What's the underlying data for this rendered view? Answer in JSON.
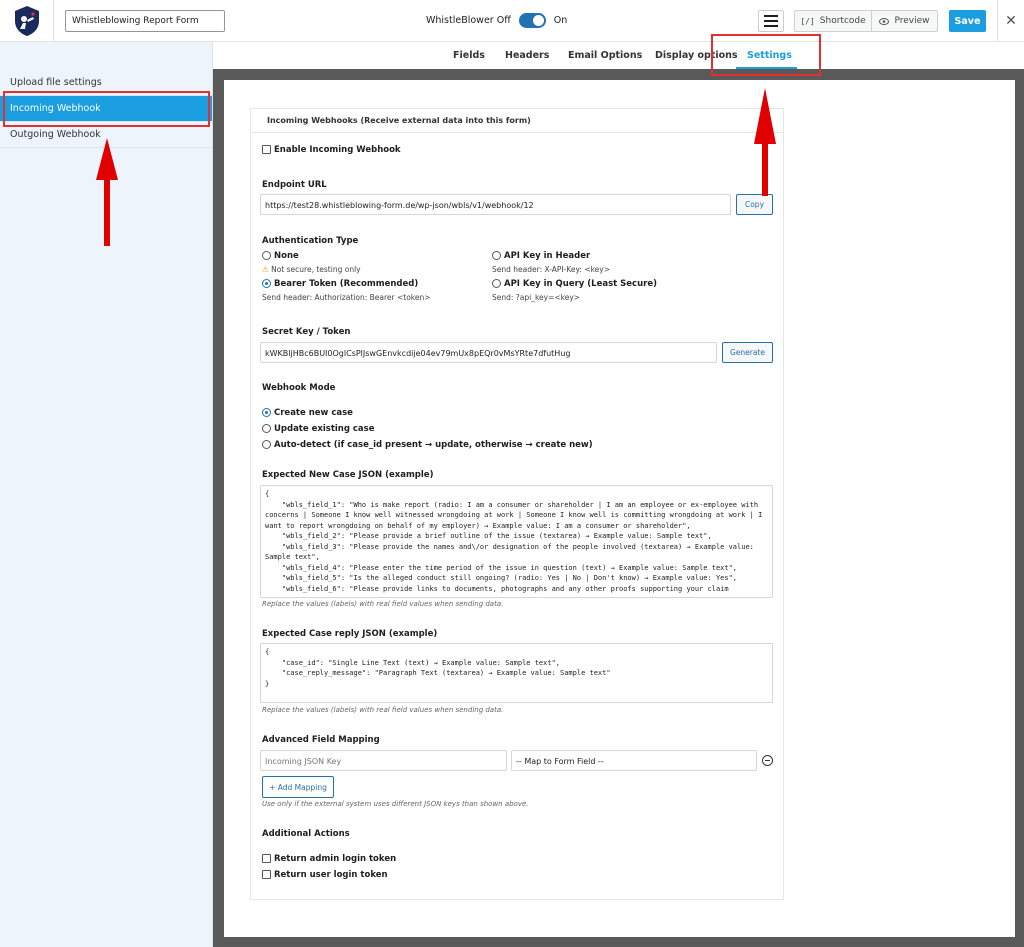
{
  "header": {
    "form_title": "Whistleblowing Report Form",
    "toggle_label_off": "WhistleBlower Off",
    "toggle_label_on": "On",
    "shortcode_label": "Shortcode",
    "shortcode_icon_text": "[/]",
    "preview_label": "Preview",
    "save_label": "Save",
    "close_icon": "close-icon",
    "accent_color": "#1a9ee0"
  },
  "sidebar": {
    "items": [
      {
        "label": "Upload file settings",
        "active": false
      },
      {
        "label": "Incoming Webhook",
        "active": true
      },
      {
        "label": "Outgoing Webhook",
        "active": false
      }
    ]
  },
  "tabs": [
    {
      "label": "Fields",
      "active": false
    },
    {
      "label": "Headers",
      "active": false
    },
    {
      "label": "Email Options",
      "active": false
    },
    {
      "label": "Display options",
      "active": false
    },
    {
      "label": "Settings",
      "active": true
    }
  ],
  "panel": {
    "header": "Incoming Webhooks (Receive external data into this form)",
    "enable_label": "Enable Incoming Webhook",
    "endpoint": {
      "label": "Endpoint URL",
      "value": "https://test28.whistleblowing-form.de/wp-json/wbls/v1/webhook/12",
      "copy_label": "Copy"
    },
    "auth": {
      "label": "Authentication Type",
      "options": [
        {
          "label": "None",
          "hint": "Not secure, testing only",
          "selected": false
        },
        {
          "label": "API Key in Header",
          "hint": "Send header: X-API-Key: <key>",
          "selected": false
        },
        {
          "label": "Bearer Token (Recommended)",
          "hint": "Send header: Authorization: Bearer <token>",
          "selected": true
        },
        {
          "label": "API Key in Query (Least Secure)",
          "hint": "Send: ?api_key=<key>",
          "selected": false
        }
      ],
      "warning_icon": "warning-icon"
    },
    "secret": {
      "label": "Secret Key / Token",
      "value": "kWKBljHBc6BUI0OglCsPlJswGEnvkcdije04ev79mUx8pEQr0vMsYRte7dfutHug",
      "generate_label": "Generate"
    },
    "mode": {
      "label": "Webhook Mode",
      "options": [
        {
          "label": "Create new case",
          "selected": true
        },
        {
          "label": "Update existing case",
          "selected": false
        },
        {
          "label": "Auto-detect (if case_id present → update, otherwise → create new)",
          "selected": false
        }
      ]
    },
    "new_case_json": {
      "label": "Expected New Case JSON (example)",
      "content": "{\n    \"wbls_field_1\": \"Who is make report (radio: I am a consumer or shareholder | I am an employee or ex-employee with concerns | Someone I know well witnessed wrongdoing at work | Someone I know well is committing wrongdoing at work | I want to report wrongdoing on behalf of my employer) → Example value: I am a consumer or shareholder\",\n    \"wbls_field_2\": \"Please provide a brief outline of the issue (textarea) → Example value: Sample text\",\n    \"wbls_field_3\": \"Please provide the names and\\/or designation of the people involved (textarea) → Example value: Sample text\",\n    \"wbls_field_4\": \"Please enter the time period of the issue in question (text) → Example value: Sample text\",\n    \"wbls_field_5\": \"Is the alleged conduct still ongoing? (radio: Yes | No | Don't know) → Example value: Yes\",\n    \"wbls_field_6\": \"Please provide links to documents, photographs and any other proofs supporting your claim",
      "hint": "Replace the values (labels) with real field values when sending data."
    },
    "reply_json": {
      "label": "Expected Case reply JSON (example)",
      "content": "{\n    \"case_id\": \"Single Line Text (text) → Example value: Sample text\",\n    \"case_reply_message\": \"Paragraph Text (textarea) → Example value: Sample text\"\n}",
      "hint": "Replace the values (labels) with real field values when sending data."
    },
    "mapping": {
      "label": "Advanced Field Mapping",
      "key_placeholder": "Incoming JSON Key",
      "select_value": "-- Map to Form Field --",
      "add_label": "+ Add Mapping",
      "hint": "Use only if the external system uses different JSON keys than shown above."
    },
    "actions": {
      "label": "Additional Actions",
      "items": [
        {
          "label": "Return admin login token",
          "checked": false
        },
        {
          "label": "Return user login token",
          "checked": false
        }
      ]
    }
  },
  "annotations": {
    "highlight_color": "#e03131"
  }
}
